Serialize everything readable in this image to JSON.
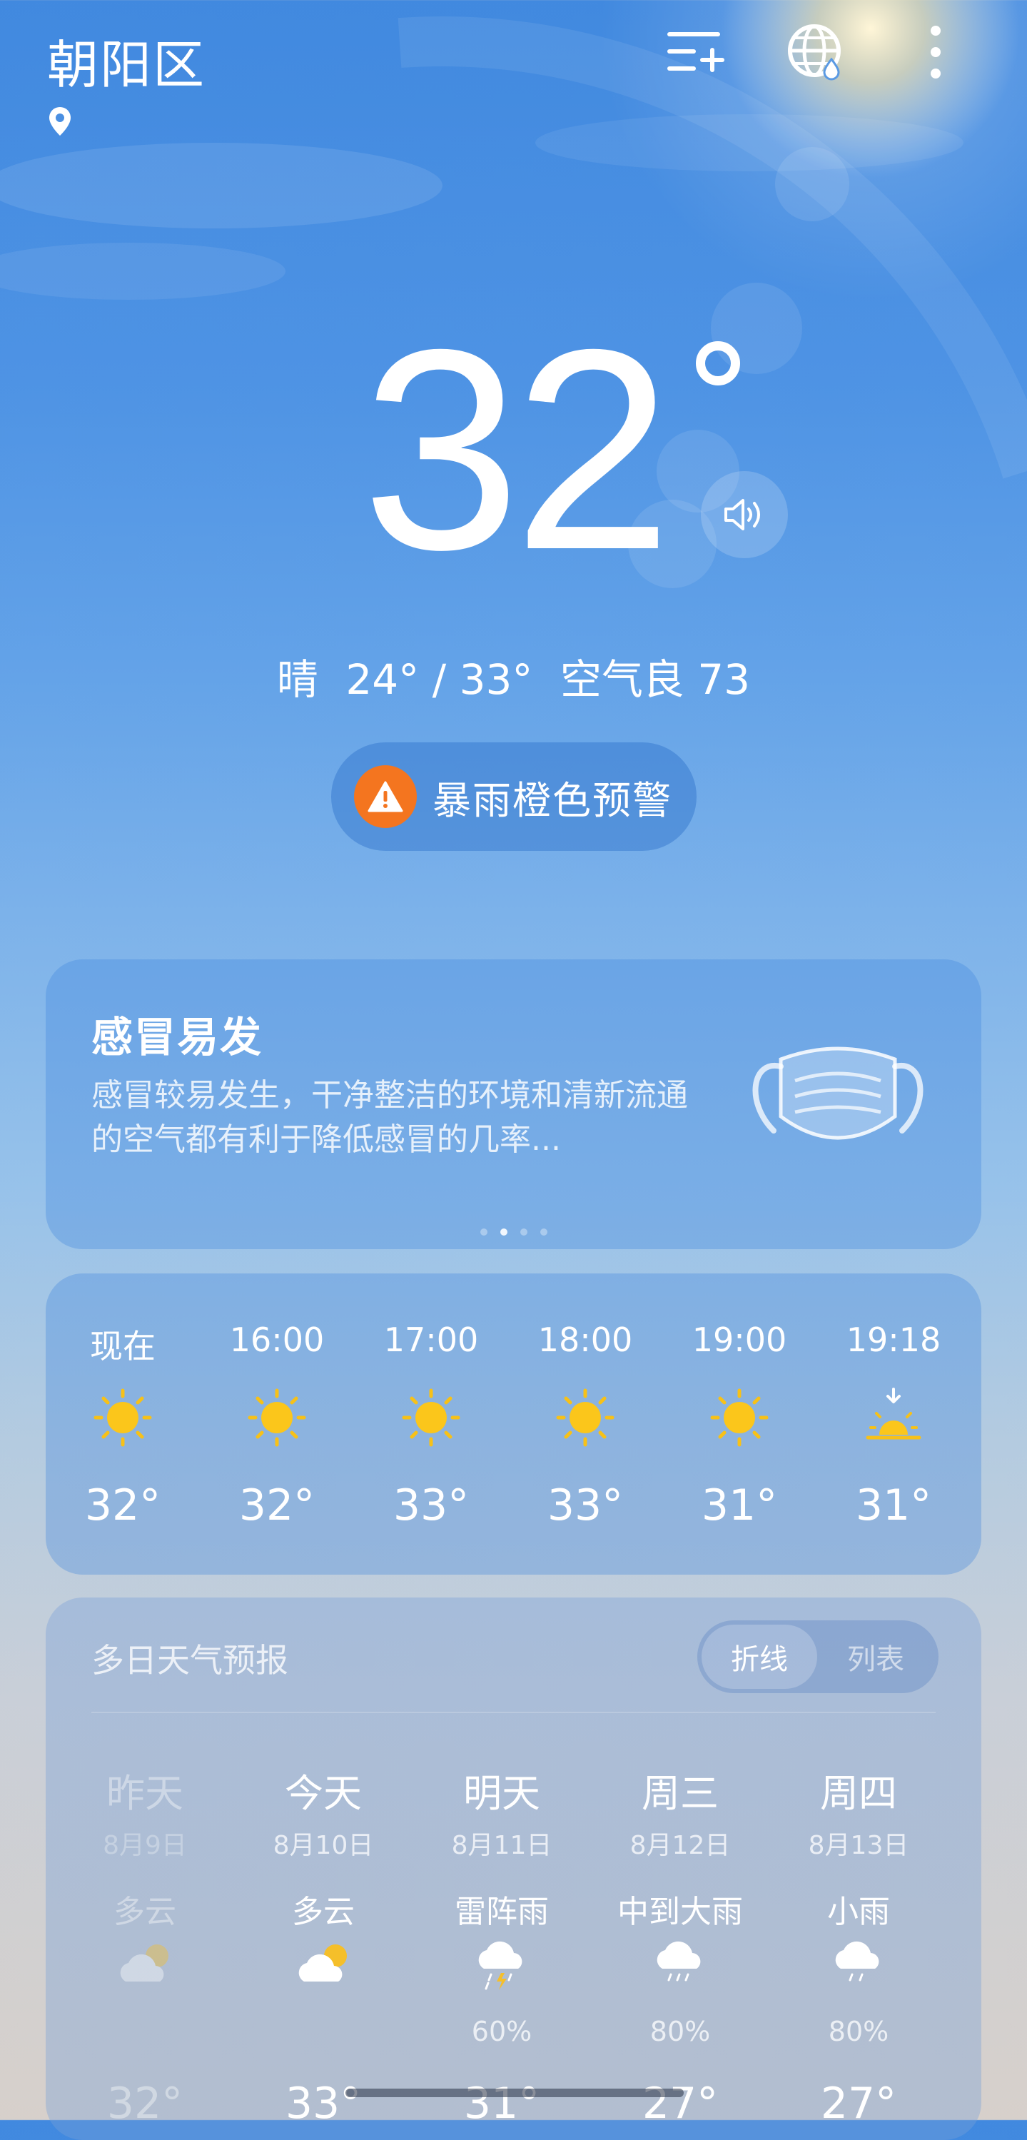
{
  "header": {
    "city": "朝阳区",
    "icons": [
      "location-pin-icon",
      "add-city-icon",
      "globe-icon",
      "more-menu-icon"
    ]
  },
  "current": {
    "temperature": "32",
    "condition": "晴",
    "range": "24° / 33°",
    "air_quality": "空气良 73",
    "speaker_icon": "speaker-icon"
  },
  "alert": {
    "label": "暴雨橙色预警",
    "color": "#f4751f",
    "icon": "warning-triangle-icon"
  },
  "flu_card": {
    "title": "感冒易发",
    "description": "感冒较易发生，干净整洁的环境和清新流通的空气都有利于降低感冒的几率...",
    "icon": "face-mask-icon",
    "page_dots": 4,
    "active_dot": 1
  },
  "hourly": [
    {
      "time": "现在",
      "icon": "sun-icon",
      "temp": "32°"
    },
    {
      "time": "16:00",
      "icon": "sun-icon",
      "temp": "32°"
    },
    {
      "time": "17:00",
      "icon": "sun-icon",
      "temp": "33°"
    },
    {
      "time": "18:00",
      "icon": "sun-icon",
      "temp": "33°"
    },
    {
      "time": "19:00",
      "icon": "sun-icon",
      "temp": "31°"
    },
    {
      "time": "19:18",
      "icon": "sunset-icon",
      "temp": "31°"
    }
  ],
  "daily": {
    "title": "多日天气预报",
    "toggle_active": "折线",
    "toggle_inactive": "列表",
    "days": [
      {
        "name": "昨天",
        "date": "8月9日",
        "condition": "多云",
        "icon": "partly-cloudy-icon",
        "pop": "",
        "temp": "32°"
      },
      {
        "name": "今天",
        "date": "8月10日",
        "condition": "多云",
        "icon": "partly-cloudy-icon",
        "pop": "",
        "temp": "33°"
      },
      {
        "name": "明天",
        "date": "8月11日",
        "condition": "雷阵雨",
        "icon": "thunderstorm-icon",
        "pop": "60%",
        "temp": "31°"
      },
      {
        "name": "周三",
        "date": "8月12日",
        "condition": "中到大雨",
        "icon": "heavy-rain-icon",
        "pop": "80%",
        "temp": "27°"
      },
      {
        "name": "周四",
        "date": "8月13日",
        "condition": "小雨",
        "icon": "light-rain-icon",
        "pop": "80%",
        "temp": "27°"
      }
    ]
  }
}
